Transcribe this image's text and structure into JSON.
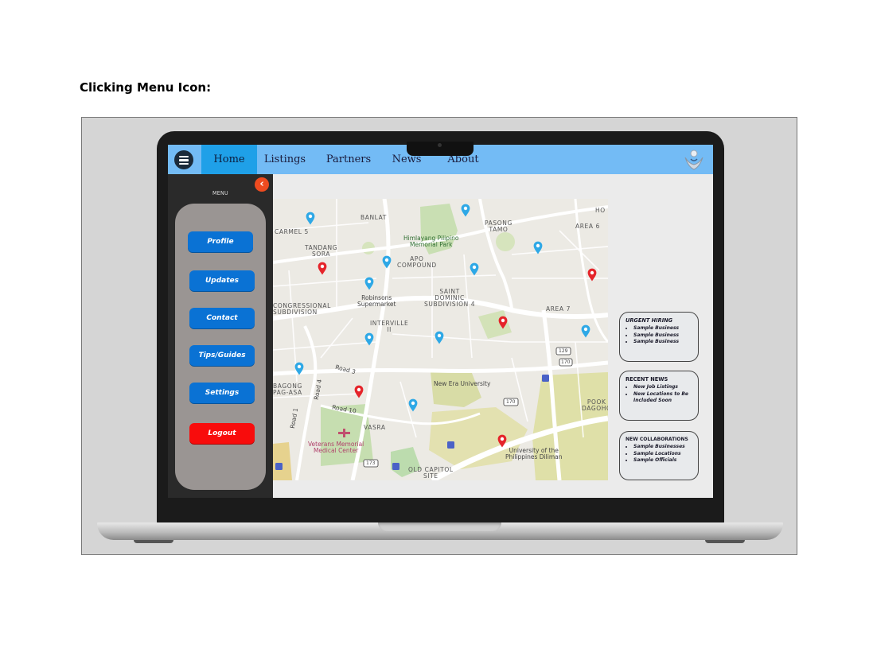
{
  "caption": "Clicking Menu Icon:",
  "nav": {
    "tabs": [
      {
        "label": "Home",
        "active": true
      },
      {
        "label": "Listings",
        "active": false
      },
      {
        "label": "Partners",
        "active": false
      },
      {
        "label": "News",
        "active": false
      },
      {
        "label": "About",
        "active": false
      }
    ],
    "menu_icon": "hamburger-icon",
    "logo_icon": "hand-logo-icon",
    "colors": {
      "bar": "#73bbf5",
      "active_tab": "#1fa0e8"
    }
  },
  "sidebar": {
    "title": "MENU",
    "back_icon": "chevron-left-icon",
    "buttons": [
      {
        "label": "Profile"
      },
      {
        "label": "Updates"
      },
      {
        "label": "Contact"
      },
      {
        "label": "Tips/Guides"
      },
      {
        "label": "Settings"
      },
      {
        "label": "Logout"
      }
    ],
    "colors": {
      "button": "#0a72d4",
      "logout": "#f80c0c",
      "panel": "#9a9593"
    }
  },
  "map": {
    "labels": {
      "banlat": "BANLAT",
      "carmel": "CARMEL 5",
      "tandang": "TANDANG\nSORA",
      "pasong": "PASONG\nTAMO",
      "area6": "AREA 6",
      "ho": "HO",
      "himlayang": "Himlayang Pilipino\nMemorial Park",
      "apo": "APO\nCOMPOUND",
      "robinsons": "Robinsons\nSupermarket",
      "saint": "SAINT\nDOMINIC\nSUBDIVISION 4",
      "area7": "AREA 7",
      "congressional": "CONGRESSIONAL\nSUBDIVISION",
      "interville": "INTERVILLE\nII",
      "road3": "Road 3",
      "newera": "New Era University",
      "bagong": "BAGONG\nPAG-ASA",
      "road4": "Road 4",
      "road10": "Road 10",
      "road1": "Road 1",
      "pook": "POOK\nDAGOHO",
      "vasra": "VASRA",
      "veterans": "Veterans Memorial\nMedical Center",
      "up": "University of the\nPhilippines Diliman",
      "oldcapitol": "OLD CAPITOL\nSITE",
      "r129": "129",
      "r170a": "170",
      "r170b": "170",
      "r173": "173"
    },
    "pins": [
      {
        "color": "#2ea8e6"
      },
      {
        "color": "#2ea8e6"
      },
      {
        "color": "#2ea8e6"
      },
      {
        "color": "#2ea8e6"
      },
      {
        "color": "#2ea8e6"
      },
      {
        "color": "#2ea8e6"
      },
      {
        "color": "#2ea8e6"
      },
      {
        "color": "#2ea8e6"
      },
      {
        "color": "#2ea8e6"
      },
      {
        "color": "#2ea8e6"
      },
      {
        "color": "#2ea8e6"
      },
      {
        "color": "#e5242a"
      },
      {
        "color": "#e5242a"
      },
      {
        "color": "#e5242a"
      },
      {
        "color": "#e5242a"
      },
      {
        "color": "#e5242a"
      }
    ]
  },
  "cards": [
    {
      "title": "URGENT HIRING",
      "items": [
        "Sample Business",
        "Sample Business",
        "Sample Business"
      ]
    },
    {
      "title": "RECENT NEWS",
      "items": [
        "New Job Listings",
        "New Locations to Be Included Soon"
      ]
    },
    {
      "title": "NEW COLLABORATIONS",
      "items": [
        "Sample Businesses",
        "Sample Locations",
        "Sample Officials"
      ]
    }
  ]
}
